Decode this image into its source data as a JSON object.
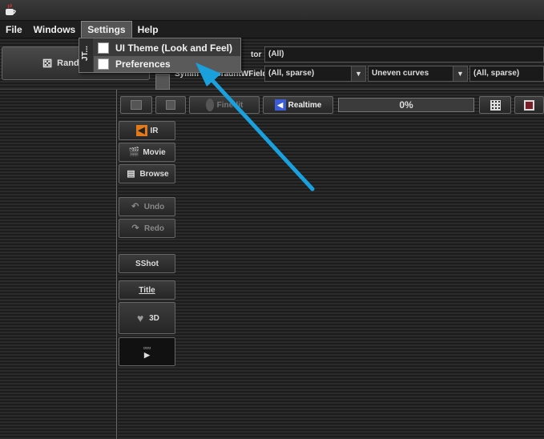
{
  "app": {
    "icon": "java-cup-icon"
  },
  "menubar": {
    "items": [
      {
        "label": "File"
      },
      {
        "label": "Windows"
      },
      {
        "label": "Settings"
      },
      {
        "label": "Help"
      }
    ]
  },
  "settings_menu": {
    "side_label": "JT...",
    "items": [
      {
        "label": "UI Theme (Look and Feel)",
        "checked": false
      },
      {
        "label": "Preferences",
        "checked": false,
        "highlighted": true
      }
    ]
  },
  "top_panel": {
    "random_button": "Rand",
    "generator_label": "tor",
    "generator_value": "(All)",
    "symmetry_label": "Symm",
    "symmetry_label_tail": "GradntWField",
    "field1_value": "(All, sparse)",
    "field2_value": "Uneven curves",
    "field3_value": "(All, sparse)"
  },
  "toolbar": {
    "finedit_label": "Fin",
    "finedit_label_tail": "edit",
    "realtime_label": "Realtime",
    "progress": "0%"
  },
  "tools": {
    "ir": "IR",
    "movie": "Movie",
    "browse": "Browse",
    "undo": "Undo",
    "redo": "Redo",
    "sshot": "SShot",
    "title": "Title",
    "threed": "3D"
  },
  "colors": {
    "arrow": "#1aa0dc",
    "realtime_icon": "#3c5bd6",
    "ir_icon": "#e07a1a"
  }
}
